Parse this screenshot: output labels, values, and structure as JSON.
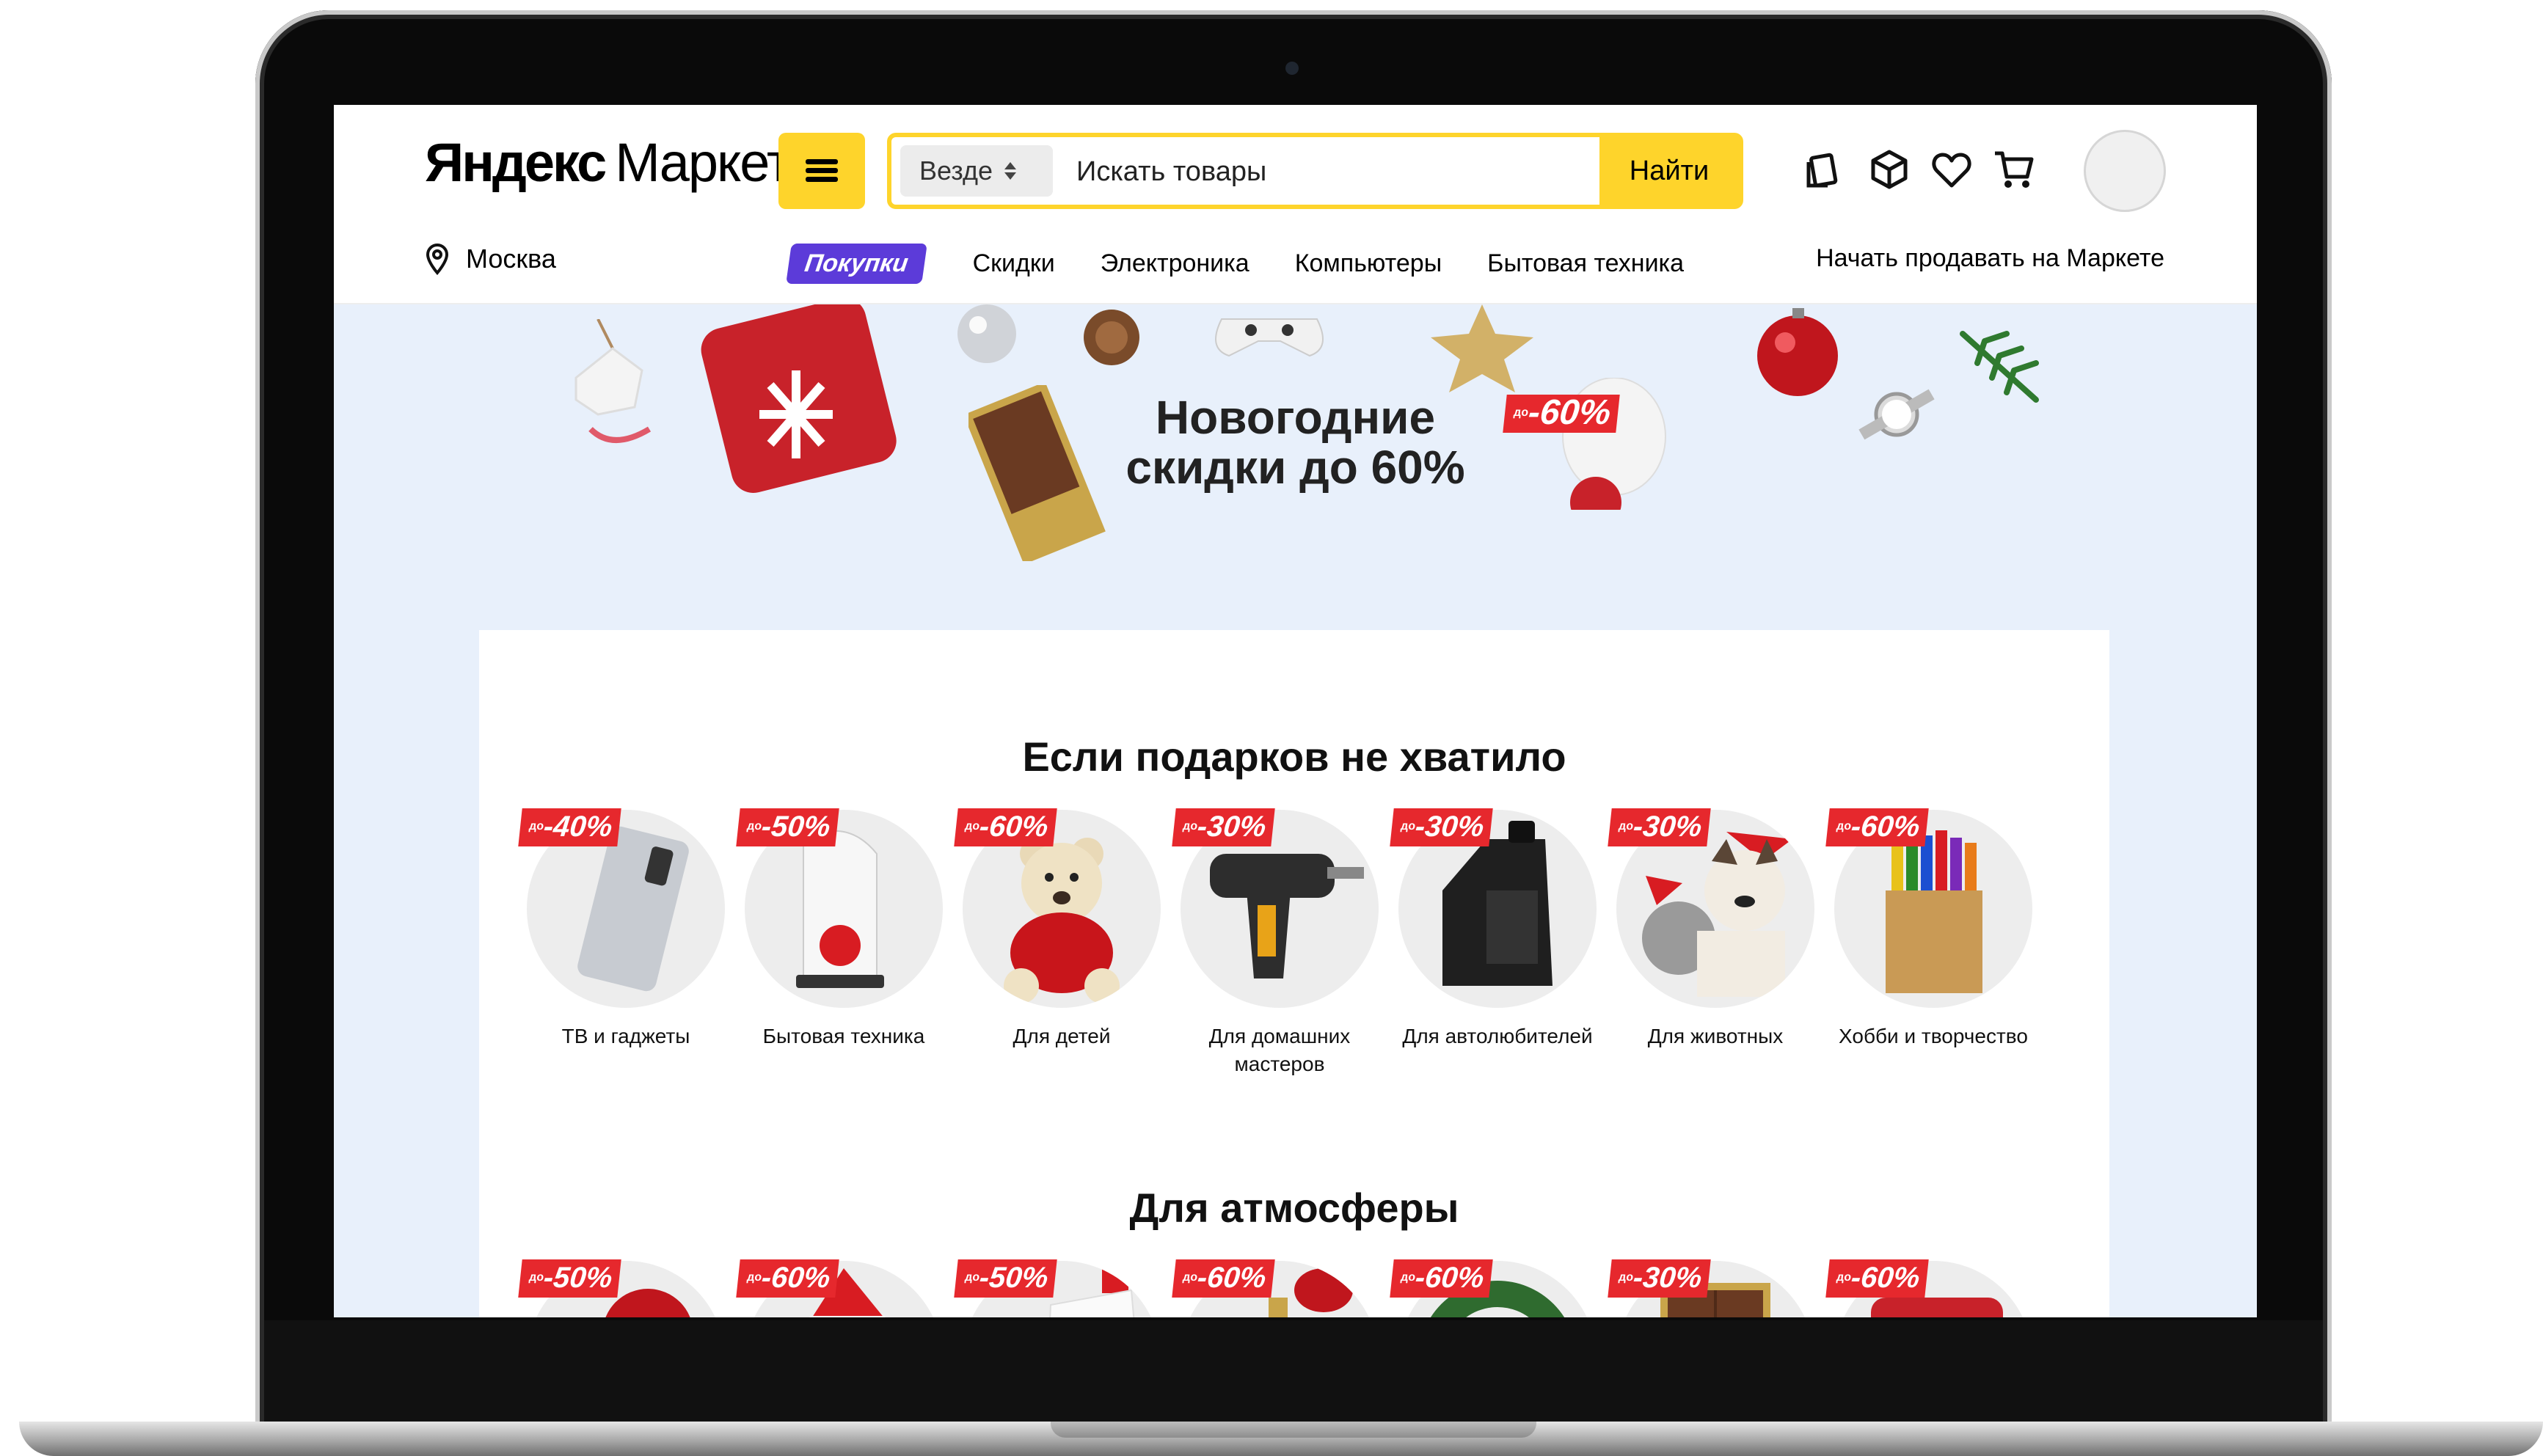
{
  "header": {
    "logo_part1": "Яндекс",
    "logo_part2": "Маркет",
    "search": {
      "scope": "Везде",
      "placeholder": "Искать товары",
      "button": "Найти"
    },
    "region": "Москва",
    "nav": {
      "active": "Покупки",
      "links": [
        "Скидки",
        "Электроника",
        "Компьютеры",
        "Бытовая техника"
      ]
    },
    "seller_link": "Начать продавать на Маркете"
  },
  "banner": {
    "title_line1": "Новогодние",
    "title_line2": "скидки до 60%",
    "badge": "-60%"
  },
  "sections": [
    {
      "title": "Если подарков не хватило",
      "items": [
        {
          "badge": "-40%",
          "label": "ТВ и гаджеты"
        },
        {
          "badge": "-50%",
          "label": "Бытовая техника"
        },
        {
          "badge": "-60%",
          "label": "Для детей"
        },
        {
          "badge": "-30%",
          "label": "Для домашних мастеров"
        },
        {
          "badge": "-30%",
          "label": "Для автолюбителей"
        },
        {
          "badge": "-30%",
          "label": "Для животных"
        },
        {
          "badge": "-60%",
          "label": "Хобби и творчество"
        }
      ]
    },
    {
      "title": "Для атмосферы",
      "items": [
        {
          "badge": "-50%"
        },
        {
          "badge": "-60%"
        },
        {
          "badge": "-50%"
        },
        {
          "badge": "-60%"
        },
        {
          "badge": "-60%"
        },
        {
          "badge": "-30%"
        },
        {
          "badge": "-60%"
        }
      ]
    }
  ],
  "badge_prefix": "до",
  "colors": {
    "yellow": "#fed42b",
    "purple": "#5c3bd9",
    "sale_red": "#e6282d",
    "banner_bg": "#e8f0fb"
  }
}
